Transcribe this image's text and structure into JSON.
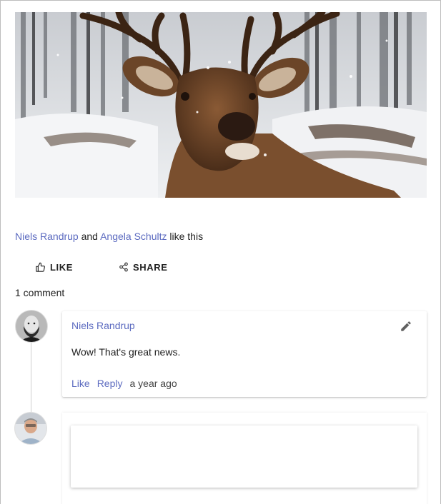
{
  "post": {
    "image": {
      "subject": "deer-in-snowy-forest"
    },
    "likes": {
      "user1": "Niels Randrup",
      "connector": "and",
      "user2": "Angela Schultz",
      "suffix": "like this"
    },
    "actions": {
      "like_label": "LIKE",
      "share_label": "SHARE"
    },
    "comment_count": "1 comment"
  },
  "comments": [
    {
      "author": "Niels Randrup",
      "text": "Wow! That's great news.",
      "like_label": "Like",
      "reply_label": "Reply",
      "timestamp": "a year ago",
      "icons": {
        "edit": "pencil-icon",
        "avatar": "bearded-man-avatar"
      }
    }
  ],
  "reply": {
    "placeholder": "",
    "icons": {
      "avatar": "current-user-avatar"
    }
  },
  "colors": {
    "link": "#5c6bc0",
    "text": "#212121",
    "border": "#bdbdbd"
  }
}
